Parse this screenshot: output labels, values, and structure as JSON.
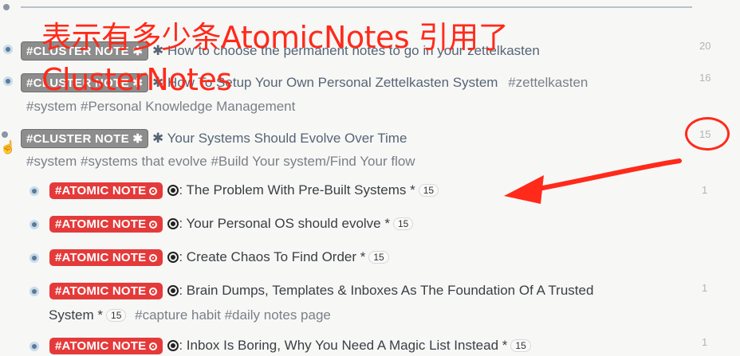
{
  "overlay": {
    "line1": "表示有多少条AtomicNotes 引用了",
    "line2": "ClusterNotes"
  },
  "rows": [
    {
      "tag": "#CLUSTER NOTE ✱",
      "title": "✱ How to choose the permanent notes to go in your zettelkasten",
      "count": "20"
    },
    {
      "tag": "#CLUSTER NOTE ✱",
      "title": "✱ How To Setup Your Own Personal Zettelkasten System",
      "hashtags1": "#zettelkasten",
      "hashtags2": "#system  #Personal Knowledge Management",
      "count": "16"
    },
    {
      "tag": "#CLUSTER NOTE ✱",
      "title": "✱ Your Systems Should Evolve Over Time",
      "hashtags2": "#system   #systems that evolve   #Build Your system/Find Your flow",
      "count": "15"
    }
  ],
  "atomic": [
    {
      "tag": "#ATOMIC NOTE",
      "title": ": The Problem With Pre-Built Systems *",
      "pill": "15",
      "count": "1"
    },
    {
      "tag": "#ATOMIC NOTE",
      "title": ": Your Personal OS should evolve *",
      "pill": "15",
      "count": ""
    },
    {
      "tag": "#ATOMIC NOTE",
      "title": ": Create Chaos To Find Order *",
      "pill": "15",
      "count": ""
    },
    {
      "tag": "#ATOMIC NOTE",
      "title": ": Brain Dumps, Templates & Inboxes As The Foundation Of A Trusted",
      "line2": "System *",
      "pill": "15",
      "hashtags": "#capture habit   #daily notes page",
      "count": "1"
    },
    {
      "tag": "#ATOMIC NOTE",
      "title": ": Inbox Is Boring, Why You Need A Magic List Instead *",
      "pill": "15",
      "count": "1"
    }
  ],
  "colors": {
    "accent_red": "#e53a3a",
    "annotation_red": "#ff2a1a",
    "cluster_grey": "#8d8d8d"
  }
}
